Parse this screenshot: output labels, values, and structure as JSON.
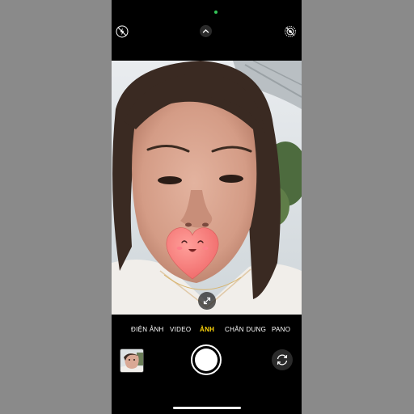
{
  "colors": {
    "side_background": "#8a8a8a",
    "accent": "#ffd60a",
    "indicator": "#34c759"
  },
  "top_controls": {
    "flash_icon": "flash-off-icon",
    "chevron_icon": "chevron-up-icon",
    "live_icon": "live-photo-icon"
  },
  "modes": {
    "items": [
      "ĐIỆN ẢNH",
      "VIDEO",
      "ẢNH",
      "CHÂN DUNG",
      "PANO"
    ],
    "selected": "ẢNH"
  },
  "bottom_controls": {
    "thumbnail": "last-photo-thumbnail",
    "shutter": "shutter-button",
    "flip_icon": "camera-flip-icon"
  },
  "viewfinder": {
    "sticker": "heart-emoji-sticker",
    "expand_icon": "expand-arrows-icon"
  }
}
